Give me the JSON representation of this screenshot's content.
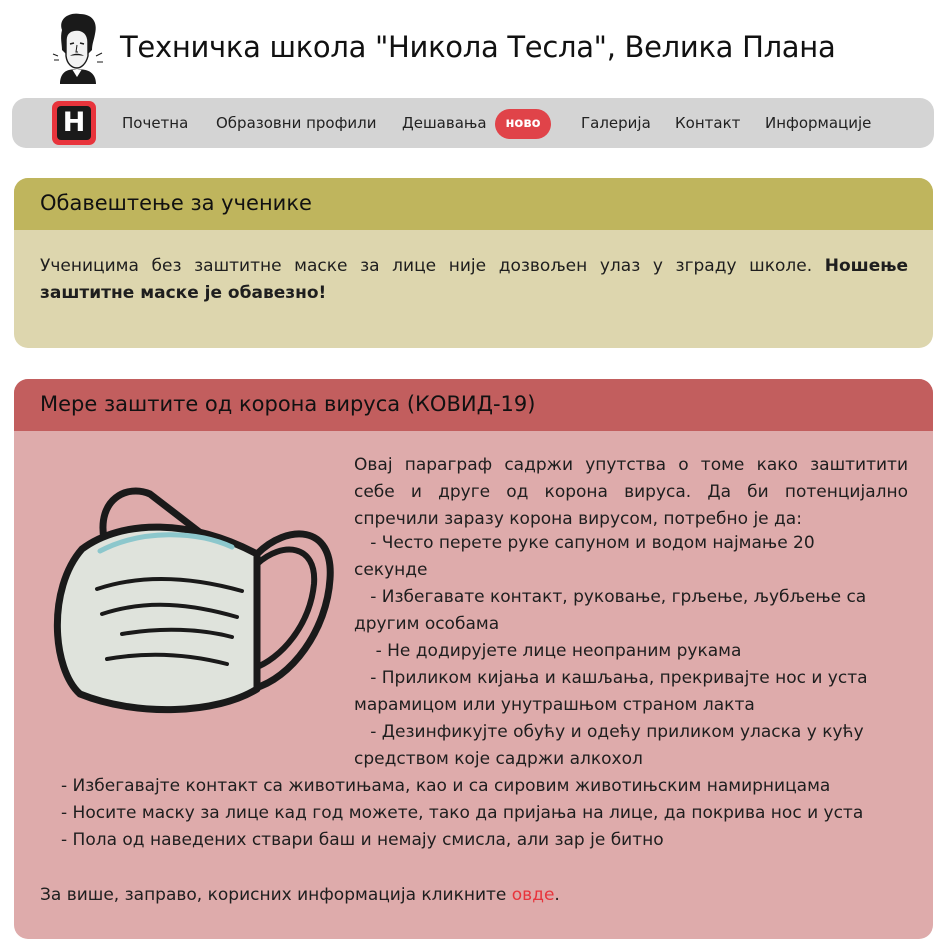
{
  "header": {
    "title": "Техничка школа \"Никола Тесла\", Велика Плана"
  },
  "nav": {
    "logo_letter": "H",
    "items": [
      "Почетна",
      "Образовни профили",
      "Дешавања",
      "Галерија",
      "Контакт",
      "Информације"
    ],
    "badge": "ново"
  },
  "notice_card": {
    "title": "Обавештење за ученике",
    "text": "Ученицима без заштитне маске за лице није дозвољен улаз у зграду школе.",
    "bold_text": "Ношење заштитне маске је обавезно!"
  },
  "covid_card": {
    "title": "Мере заштите од корона вируса (КОВИД-19)",
    "intro_lines": [
      "Овај параграф садржи упутства о томе како заштитити",
      "себе и друге од корона вируса. Да би потенцијално",
      "спречили заразу корона вирусом, потребно је да:"
    ],
    "side_lines": [
      "   - Често перете руке сапуном и водом најмање 20",
      "секунде",
      "   - Избегавате контакт, руковање, грљење, љубљење са",
      "другим особама",
      "    - Не додирујете лице неопраним рукама",
      "   - Приликом кијања и кашљања, прекривајте нос и уста",
      "марамицом или унутрашњом страном лакта",
      "   - Дезинфикујте обућу и одећу приликом уласка у кућу",
      "средством које садржи алкохол"
    ],
    "full_lines": [
      "- Избегавајте контакт са животињама, као и са сировим животињским намирницама",
      "- Носите маску за лице кад год можете, тако да пријања на лице, да покрива нос и уста",
      "- Пола од наведених ствари баш и немају смисла, али зар је битно"
    ],
    "more_prefix": "За више, заправо, корисних информација кликните ",
    "more_link": "овде",
    "more_suffix": "."
  },
  "colors": {
    "notice_header": "#bfb55d",
    "notice_body": "#ddd6ae",
    "covid_header": "#c25e5e",
    "covid_body": "#deabab",
    "badge": "#e04349",
    "link": "#e8343c"
  }
}
